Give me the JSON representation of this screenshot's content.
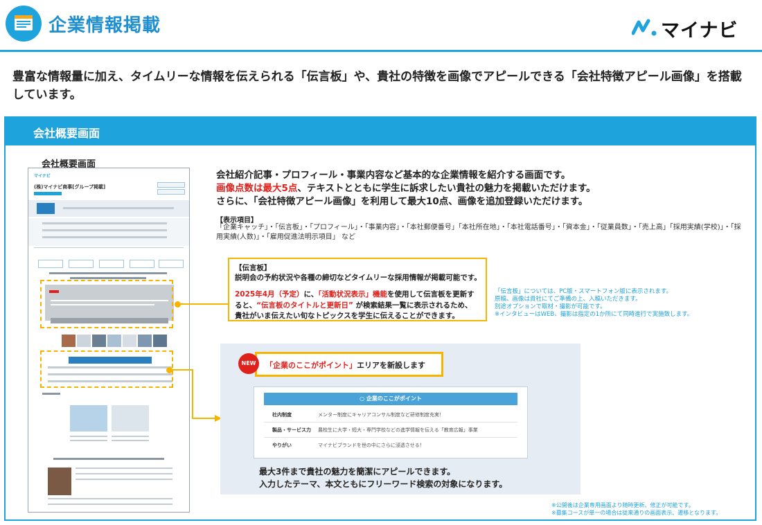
{
  "header": {
    "title": "企業情報掲載",
    "icon": "document-icon",
    "logo_text": "マイナビ",
    "accent": "#1ea3dc"
  },
  "lead": "豊富な情報量に加え、タイムリーな情報を伝えられる「伝言板」や、貴社の特徴を画像でアピールできる「会社特徴アピール画像」を搭載しています。",
  "section": {
    "title": "会社概要画面",
    "screen_label": "会社概要画面"
  },
  "mock": {
    "company": "(株)マイナビ商事[グループ掲載]"
  },
  "description": {
    "line1": "会社紹介記事・プロフィール・事業内容など基本的な企業情報を紹介する画面です。",
    "line2_red": "画像点数は最大5点",
    "line2_rest": "、テキストとともに学生に訴求したい貴社の魅力を掲載いただけます。",
    "line3": "さらに、「会社特徴アピール画像」を利用して最大10点、画像を追加登録いただけます。"
  },
  "display_items": {
    "heading": "【表示項目】",
    "text": "「企業キャッチ」・「伝言板」・「プロフィール」・「事業内容」・「本社郵便番号」「本社所在地」・「本社電話番号」・「資本金」・「従業員数」・「売上高」「採用実績(学校)」・「採用実績(人数)」・「雇用促進法明示項目」 など"
  },
  "dengon": {
    "heading": "【伝言板】",
    "line1": "説明会の予約状況や各種の締切などタイムリーな採用情報が掲載可能です。",
    "line2_red1": "2025年4月（予定）",
    "line2_mid1": "に、",
    "line2_red2": "「活動状況表示」機能",
    "line2_mid2": "を使用して伝言板を更新す",
    "line3_pre": "ると、",
    "line3_red": "“伝言板のタイトルと更新日”",
    "line3_post": " が検索結果一覧に表示されるため、",
    "line4": "貴社がいま伝えたい旬なトピックスを学生に伝えることができます。"
  },
  "side_note": [
    "「伝言板」については、PC版・スマートフォン版に表示されます。",
    "原稿、画像は貴社にてご準備の上、入稿いただきます。",
    "別途オプションで取材・撮影が可能です。",
    "※インタビューはWEB、撮影は指定の1か所にて同時進行で実施致します。"
  ],
  "new_area": {
    "badge": "NEW",
    "title_red": "「企業のここがポイント」",
    "title_rest": "エリアを新設します",
    "card_title": "企業のここがポイント",
    "rows": [
      {
        "key": "社内制度",
        "value": "メンター制度にキャリアコンサル制度など研修制度充実！"
      },
      {
        "key": "製品・サービス力",
        "value": "農校生に大学・短大・専門学校などの進学情報を伝える「教育広報」事業"
      },
      {
        "key": "やりがい",
        "value": "マイナビブランドを世の中にさらに浸透させる！"
      }
    ],
    "text1": "最大3件まで貴社の魅力を簡潔にアピールできます。",
    "text2": "入力したテーマ、本文ともにフリーワード検索の対象になります。"
  },
  "footnotes": [
    "※公開後は企業専用画面より随時更新、修正が可能です。",
    "※募集コースが単一の場合は従来通りの画面表示、遷移となります。"
  ],
  "colors": {
    "red": "#e0201b",
    "yellow": "#f4b400",
    "blue": "#1ea3dc"
  }
}
